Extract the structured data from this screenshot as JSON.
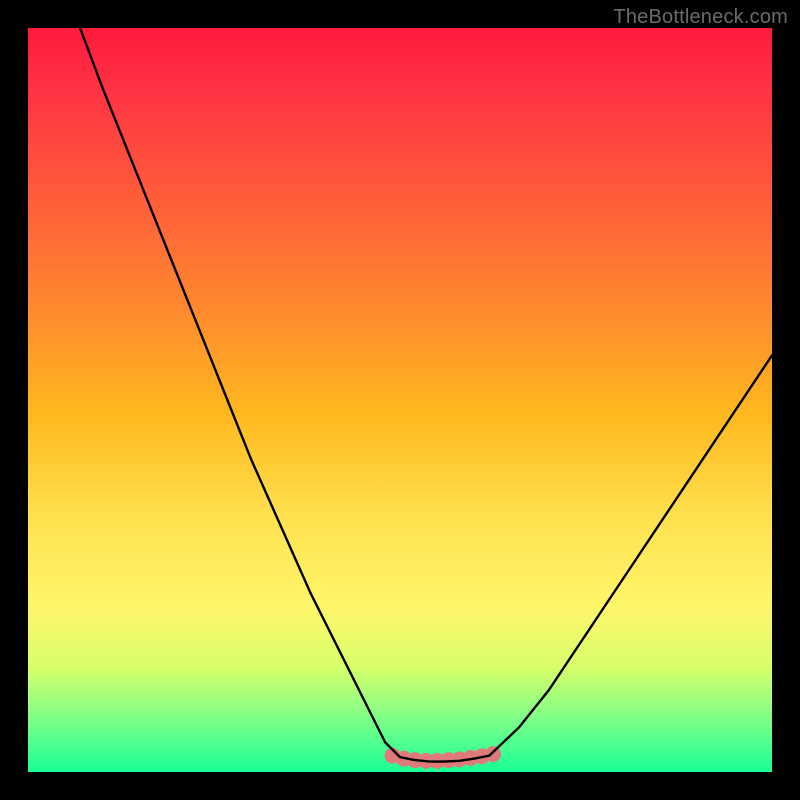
{
  "watermark": "TheBottleneck.com",
  "chart_data": {
    "type": "line",
    "title": "",
    "xlabel": "",
    "ylabel": "",
    "xlim": [
      0,
      100
    ],
    "ylim": [
      0,
      100
    ],
    "series": [
      {
        "name": "left-curve",
        "x": [
          7,
          10,
          14,
          18,
          22,
          26,
          30,
          34,
          38,
          42,
          46,
          48,
          50
        ],
        "y": [
          100,
          92,
          82,
          72,
          62,
          52,
          42,
          33,
          24,
          16,
          8,
          4,
          2
        ]
      },
      {
        "name": "valley-floor",
        "x": [
          50,
          52,
          54,
          56,
          58,
          60,
          62
        ],
        "y": [
          2,
          1.6,
          1.4,
          1.4,
          1.5,
          1.8,
          2.2
        ]
      },
      {
        "name": "right-curve",
        "x": [
          62,
          66,
          70,
          74,
          78,
          82,
          86,
          90,
          94,
          98,
          100
        ],
        "y": [
          2.2,
          6,
          11,
          17,
          23,
          29,
          35,
          41,
          47,
          53,
          56
        ]
      }
    ],
    "valley_dots": {
      "x": [
        49.0,
        50.5,
        52.0,
        53.5,
        55.0,
        56.5,
        58.0,
        59.5,
        61.0,
        62.5
      ],
      "y": [
        2.2,
        1.8,
        1.6,
        1.5,
        1.5,
        1.6,
        1.7,
        1.9,
        2.1,
        2.4
      ],
      "color": "#e07a7a",
      "radius": 8
    }
  }
}
